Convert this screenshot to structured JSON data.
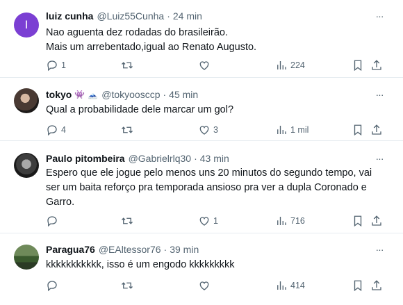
{
  "tweets": [
    {
      "name": "luiz cunha",
      "handle": "@Luiz55Cunha",
      "time": "24 min",
      "lines": [
        "Nao aguenta dez rodadas do brasileirão.",
        "Mais um arrebentado,igual ao Renato Augusto."
      ],
      "avatar_letter": "I",
      "avatar_color": "#7b3fd3",
      "replies": "1",
      "retweets": "",
      "likes": "",
      "views": "224"
    },
    {
      "name": "tokyo",
      "handle": "@tokyoosccp",
      "time": "45 min",
      "lines": [
        "Qual a probabilidade dele marcar um gol?"
      ],
      "replies": "4",
      "retweets": "",
      "likes": "3",
      "views": "1 mil"
    },
    {
      "name": "Paulo pitombeira",
      "handle": "@Gabrielrlq30",
      "time": "43 min",
      "lines": [
        "Espero que ele jogue pelo menos uns 20 minutos do segundo tempo, vai",
        "ser um baita reforço pra temporada ansioso pra ver a dupla Coronado e",
        "Garro."
      ],
      "replies": "",
      "retweets": "",
      "likes": "1",
      "views": "716"
    },
    {
      "name": "Paragua76",
      "handle": "@EAltessor76",
      "time": "39 min",
      "lines": [
        "kkkkkkkkkkk, isso é um engodo kkkkkkkkk"
      ],
      "replies": "",
      "retweets": "",
      "likes": "",
      "views": "414"
    }
  ],
  "ui": {
    "more": "···",
    "separator": "·"
  },
  "icons": [
    "reply-icon",
    "retweet-icon",
    "like-icon",
    "views-icon",
    "bookmark-icon",
    "share-icon",
    "more-icon"
  ]
}
